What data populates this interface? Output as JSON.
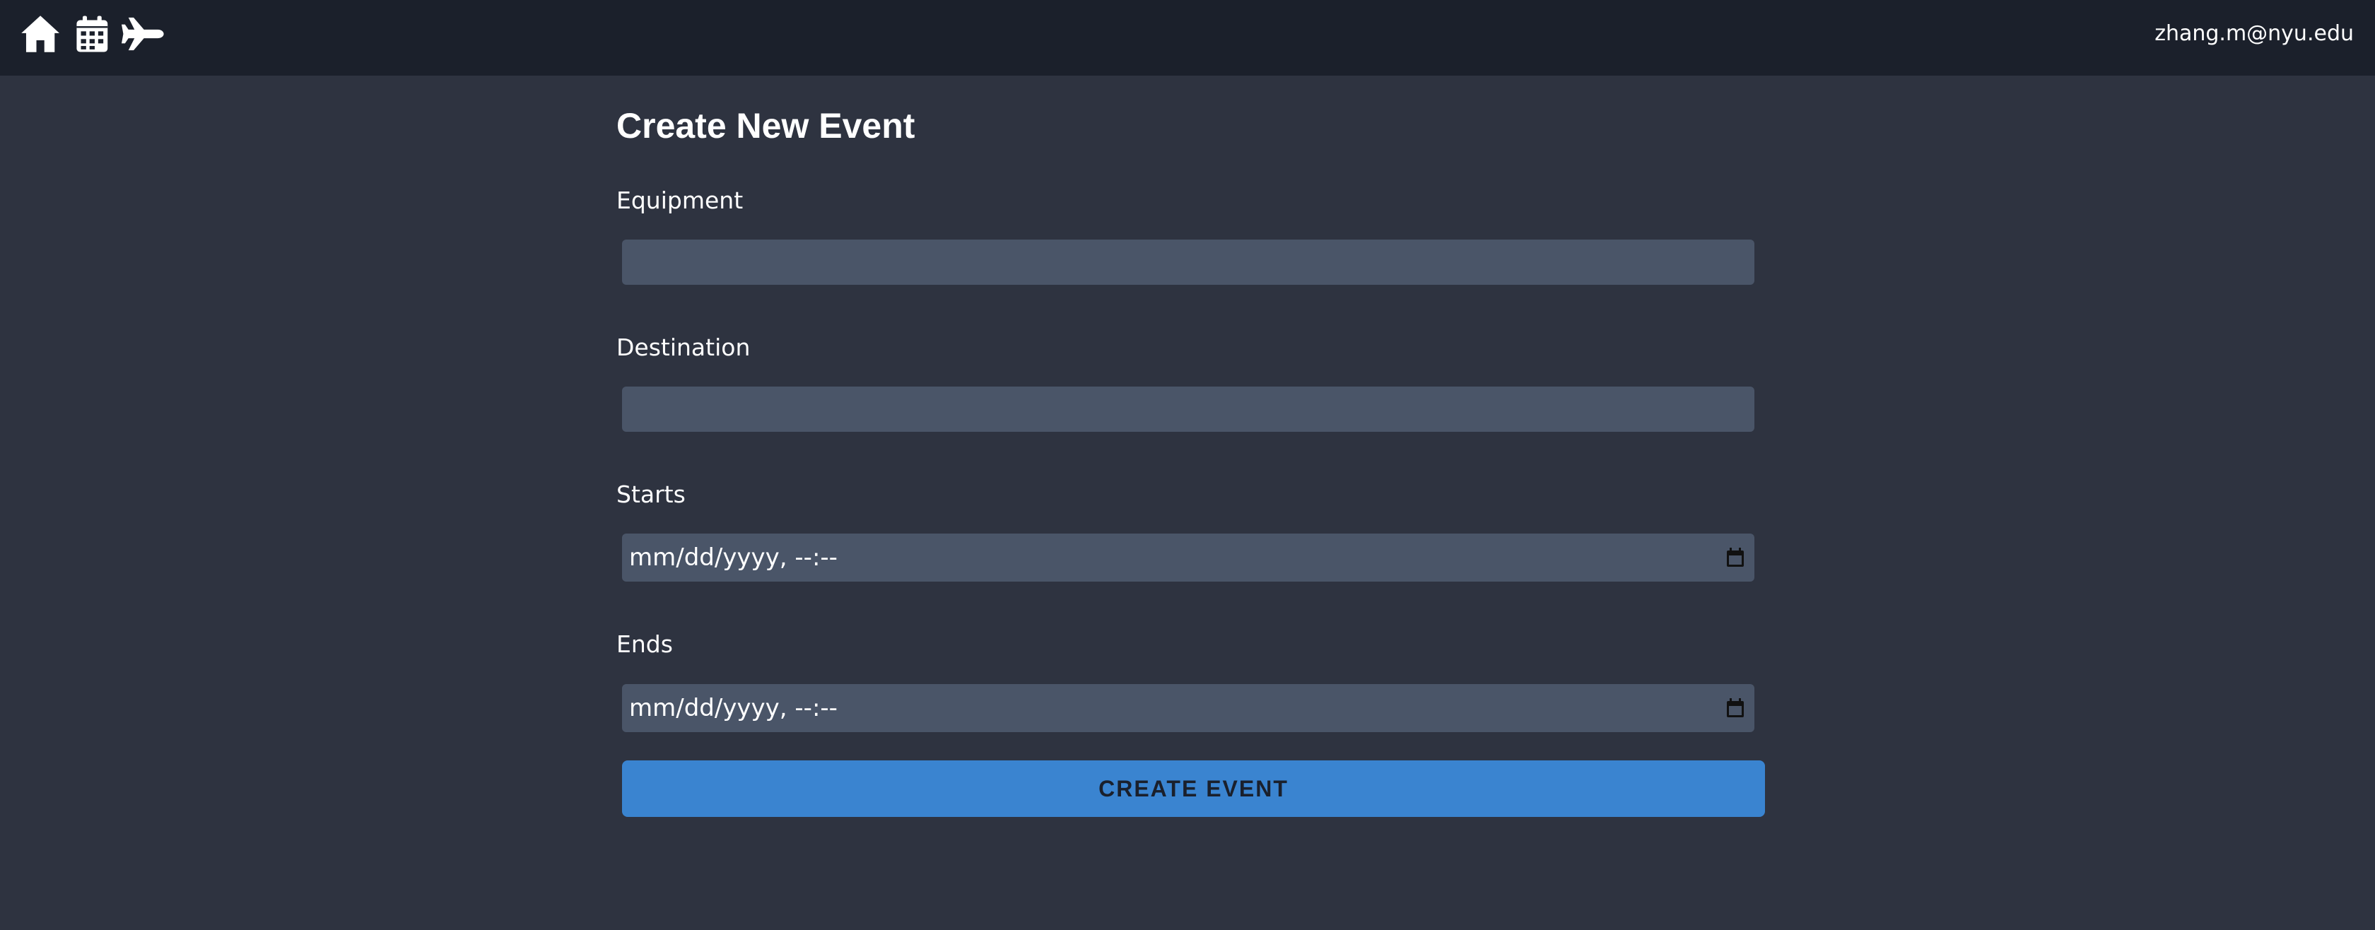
{
  "nav": {
    "icons": [
      "home-icon",
      "calendar-icon",
      "plane-icon"
    ],
    "user_email": "zhang.m@nyu.edu"
  },
  "form": {
    "title": "Create New Event",
    "equipment": {
      "label": "Equipment",
      "value": "",
      "placeholder": ""
    },
    "destination": {
      "label": "Destination",
      "value": "",
      "placeholder": ""
    },
    "starts": {
      "label": "Starts",
      "display": "mm/dd/yyyy, --:--"
    },
    "ends": {
      "label": "Ends",
      "display": "mm/dd/yyyy, --:--"
    },
    "submit_label": "CREATE EVENT"
  },
  "colors": {
    "topbar": "#1b202b",
    "background": "#2e3340",
    "input": "#4a5568",
    "accent": "#3a84d0"
  }
}
